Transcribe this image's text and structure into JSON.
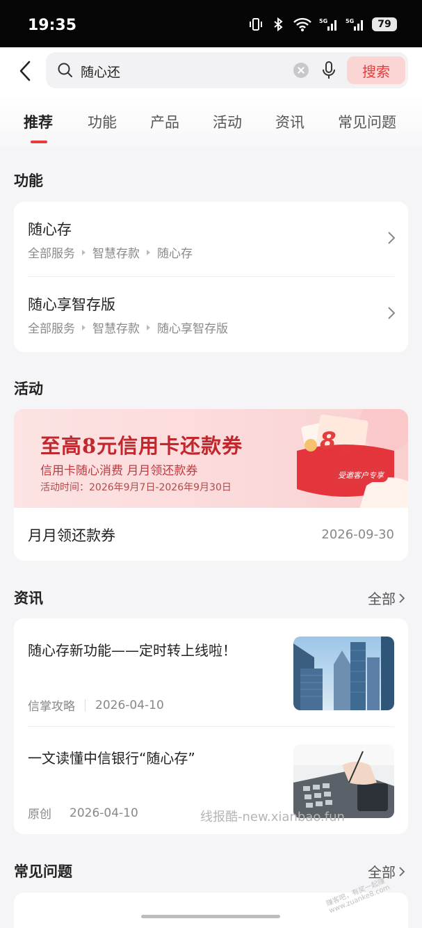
{
  "status_bar": {
    "time": "19:35",
    "battery": "79"
  },
  "search": {
    "query": "随心还",
    "button": "搜索"
  },
  "tabs": [
    {
      "label": "推荐",
      "active": true
    },
    {
      "label": "功能"
    },
    {
      "label": "产品"
    },
    {
      "label": "活动"
    },
    {
      "label": "资讯"
    },
    {
      "label": "常见问题"
    }
  ],
  "functions": {
    "title": "功能",
    "items": [
      {
        "title": "随心存",
        "path": [
          "全部服务",
          "智慧存款",
          "随心存"
        ]
      },
      {
        "title": "随心享智存版",
        "path": [
          "全部服务",
          "智慧存款",
          "随心享智存版"
        ]
      }
    ]
  },
  "activities": {
    "title": "活动",
    "banner": {
      "headline": "至高8元信用卡还款券",
      "subline": "信用卡随心消费 月月领还款券",
      "date": "活动时间：2026年9月7日-2026年9月30日",
      "amount": "8",
      "amount_unit": "元",
      "badge": "受邀客户专享"
    },
    "item": {
      "title": "月月领还款券",
      "date": "2026-09-30"
    }
  },
  "news": {
    "title": "资讯",
    "more": "全部",
    "items": [
      {
        "title": "随心存新功能——定时转上线啦！",
        "source": "信掌攻略",
        "date": "2026-04-10"
      },
      {
        "title": "一文读懂中信银行“随心存”",
        "source": "原创",
        "date": "2026-04-10"
      }
    ]
  },
  "faq": {
    "title": "常见问题",
    "more": "全部"
  },
  "watermark": "线报酷-new.xianbao.fun",
  "stamp": "赚客吧，有奖一起赚 www.zuanke8.com",
  "colors": {
    "accent": "#e53d3d",
    "search_button_bg": "#fbd4d4",
    "page_bg": "#f5f5f7"
  }
}
